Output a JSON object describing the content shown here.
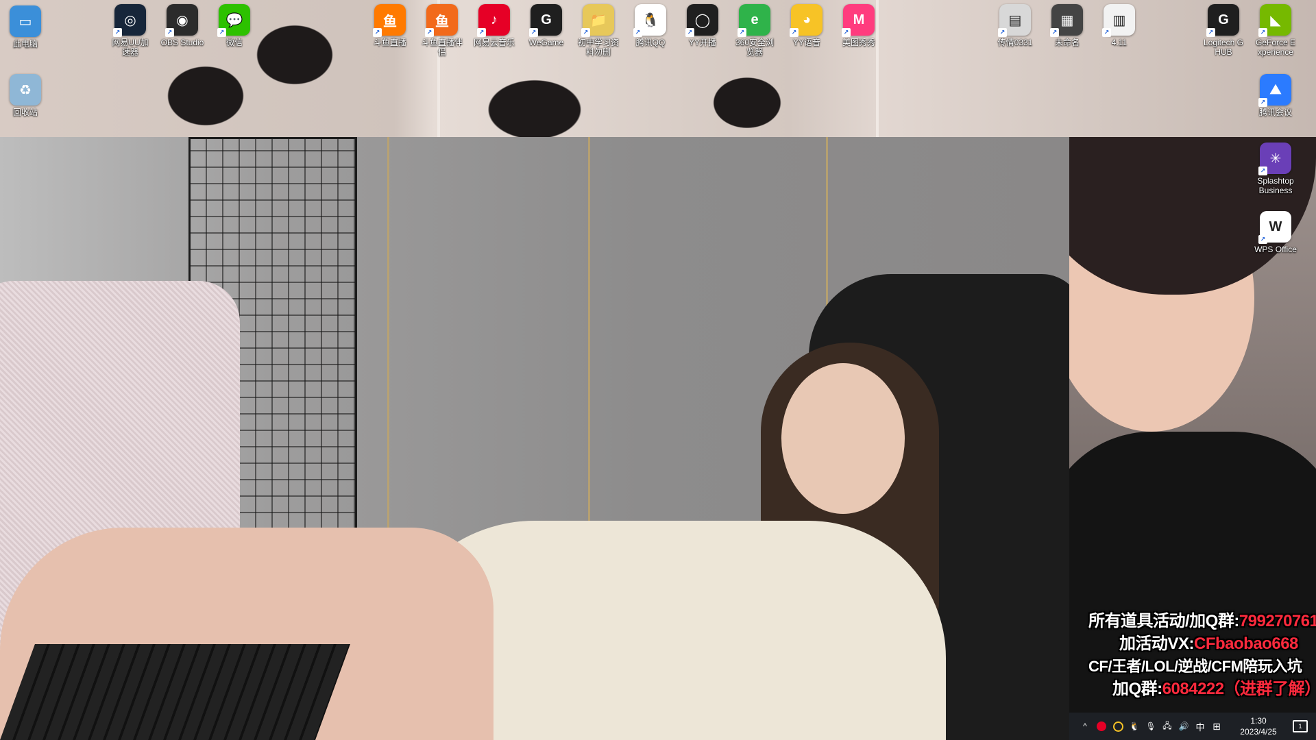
{
  "desktop": {
    "icons": [
      {
        "label": "此电脑",
        "glyph": "▭",
        "color": "#3b8fd9"
      },
      {
        "label": "回收站",
        "glyph": "♻",
        "color": "#8fb7d6"
      },
      {
        "label": "网易UU加速器",
        "glyph": "◎",
        "color": "#17263a"
      },
      {
        "label": "OBS Studio",
        "glyph": "◉",
        "color": "#2b2b2b"
      },
      {
        "label": "微信",
        "glyph": "💬",
        "color": "#2dc100"
      },
      {
        "label": "斗鱼直播",
        "glyph": "鱼",
        "color": "#ff7a00"
      },
      {
        "label": "斗鱼直播伴侣",
        "glyph": "鱼",
        "color": "#f26a1b"
      },
      {
        "label": "网易云音乐",
        "glyph": "♪",
        "color": "#e60026"
      },
      {
        "label": "WeGame",
        "glyph": "G",
        "color": "#1f1f1f"
      },
      {
        "label": "初中学习资料勿删",
        "glyph": "📁",
        "color": "#e7c85a"
      },
      {
        "label": "腾讯QQ",
        "glyph": "🐧",
        "color": "#ffffff"
      },
      {
        "label": "YY开播",
        "glyph": "◯",
        "color": "#1f1f1f"
      },
      {
        "label": "360安全浏览器",
        "glyph": "e",
        "color": "#2fb34a"
      },
      {
        "label": "YY语音",
        "glyph": "◕",
        "color": "#f7c326"
      },
      {
        "label": "美图秀秀",
        "glyph": "M",
        "color": "#ff3c7e"
      },
      {
        "label": "传情0331",
        "glyph": "▤",
        "color": "#d8d8d8"
      },
      {
        "label": "未命名",
        "glyph": "▦",
        "color": "#444444"
      },
      {
        "label": "4.11",
        "glyph": "▥",
        "color": "#f2f2f2"
      },
      {
        "label": "Logitech G HUB",
        "glyph": "G",
        "color": "#1f1f1f"
      },
      {
        "label": "GeForce Experience",
        "glyph": "◣",
        "color": "#76b900"
      },
      {
        "label": "腾讯会议",
        "glyph": "⛰",
        "color": "#2b7bff"
      },
      {
        "label": "Splashtop Business",
        "glyph": "✳",
        "color": "#6a3fb7"
      },
      {
        "label": "WPS Office",
        "glyph": "W",
        "color": "#ffffff"
      }
    ]
  },
  "overlay": {
    "line1_prefix": "所有道具活动/加Q群:",
    "line1_value": "799270761",
    "line2_prefix": "加活动VX:",
    "line2_value": "CFbaobao668",
    "line3": "CF/王者/LOL/逆战/CFM陪玩入坑",
    "line4_prefix": "加Q群:",
    "line4_value": "6084222（进群了解）"
  },
  "taskbar": {
    "chevron": "^",
    "ime": "中",
    "grid": "⊞",
    "time": "1:30",
    "date": "2023/4/25",
    "notifications": "1"
  },
  "colors": {
    "overlay_red": "#ff2a3d",
    "taskbar_bg": "#1d2025"
  }
}
